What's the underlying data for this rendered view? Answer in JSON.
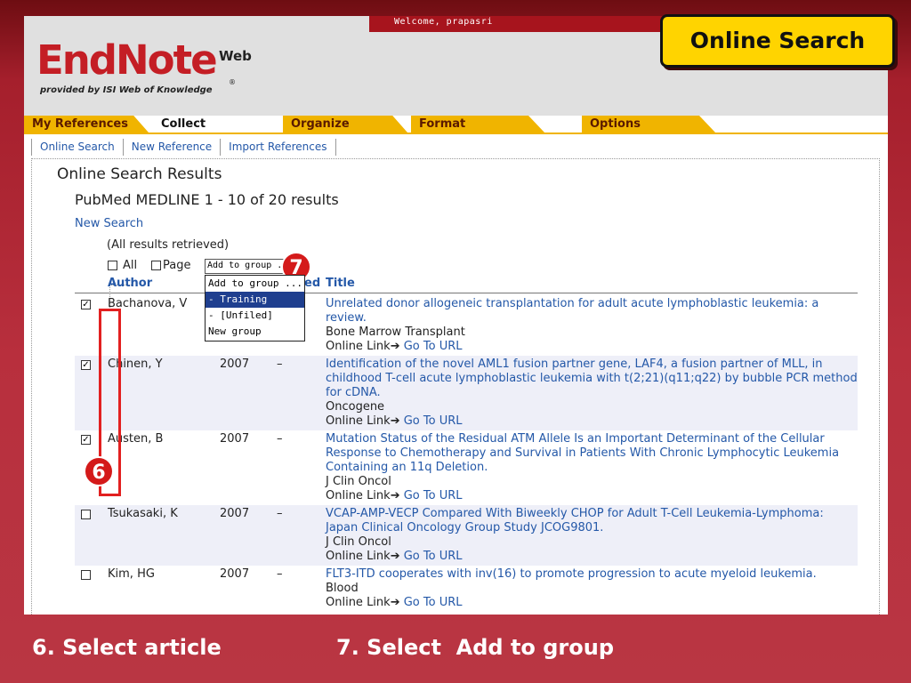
{
  "header": {
    "welcome": "Welcome, prapasri",
    "logo": "EndNote",
    "logo_web": "Web",
    "logo_tagline": "provided by ISI Web of Knowledge",
    "logo_reg": "®"
  },
  "tabs": [
    {
      "label": "My References"
    },
    {
      "label": "Collect"
    },
    {
      "label": "Organize"
    },
    {
      "label": "Format"
    },
    {
      "label": "Options"
    }
  ],
  "subnav": [
    "Online Search",
    "New Reference",
    "Import References"
  ],
  "results": {
    "heading": "Online Search Results",
    "subheading": "PubMed MEDLINE 1 - 10 of 20 results",
    "new_search": "New Search",
    "retrieved": "(All results retrieved)",
    "select_all": "All",
    "select_page": "Page",
    "group_select_value": "Add to group ...",
    "dropdown_options": [
      "Add to group ...",
      "- Training",
      "- [Unfiled]",
      "New group"
    ],
    "dropdown_selected": 1
  },
  "columns": {
    "author": "Author",
    "year_partial": "ed",
    "title": "Title"
  },
  "rows": [
    {
      "checked": true,
      "author": "Bachanova, V",
      "year": "",
      "dash": "",
      "title": "Unrelated donor allogeneic transplantation for adult acute lymphoblastic leukemia: a review.",
      "journal": "Bone Marrow Transplant",
      "link_label": "Online Link",
      "link": "Go To URL"
    },
    {
      "checked": true,
      "author": "Chinen, Y",
      "year": "2007",
      "dash": "–",
      "title": "Identification of the novel AML1 fusion partner gene, LAF4, a fusion partner of MLL, in childhood T-cell acute lymphoblastic leukemia with t(2;21)(q11;q22) by bubble PCR method for cDNA.",
      "journal": "Oncogene",
      "link_label": "Online Link",
      "link": "Go To URL"
    },
    {
      "checked": true,
      "author": "Austen, B",
      "year": "2007",
      "dash": "–",
      "title": "Mutation Status of the Residual ATM Allele Is an Important Determinant of the Cellular Response to Chemotherapy and Survival in Patients With Chronic Lymphocytic Leukemia Containing an 11q Deletion.",
      "journal": "J Clin Oncol",
      "link_label": "Online Link",
      "link": "Go To URL"
    },
    {
      "checked": false,
      "author": "Tsukasaki, K",
      "year": "2007",
      "dash": "–",
      "title": "VCAP-AMP-VECP Compared With Biweekly CHOP for Adult T-Cell Leukemia-Lymphoma: Japan Clinical Oncology Group Study JCOG9801.",
      "journal": "J Clin Oncol",
      "link_label": "Online Link",
      "link": "Go To URL"
    },
    {
      "checked": false,
      "author": "Kim, HG",
      "year": "2007",
      "dash": "–",
      "title": "FLT3-ITD cooperates with inv(16) to promote progression to acute myeloid leukemia.",
      "journal": "Blood",
      "link_label": "Online Link",
      "link": "Go To URL"
    }
  ],
  "annotations": {
    "callout": "Online Search",
    "badge_7": "7",
    "badge_6": "6",
    "caption_6": "6. Select article",
    "caption_7": "7. Select  Add to group"
  },
  "colors": {
    "accent": "#c41e25",
    "tab": "#f0b400",
    "link": "#2458a8",
    "callout": "#ffd400"
  }
}
